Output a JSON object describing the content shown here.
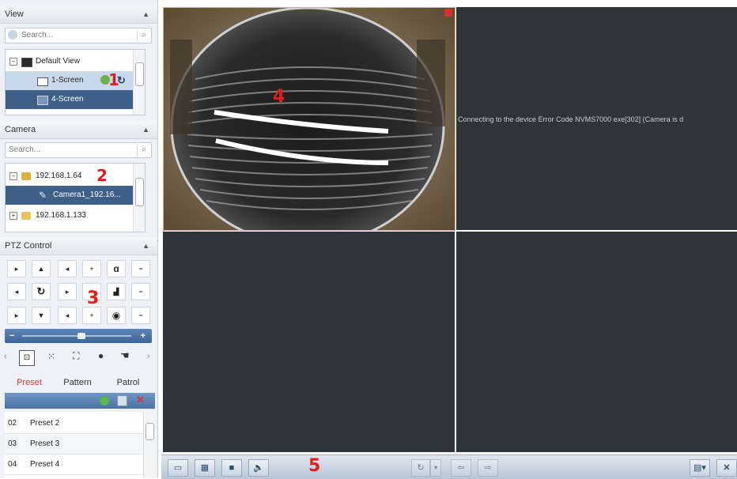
{
  "view_panel": {
    "title": "View",
    "search_placeholder": "Search...",
    "items": [
      {
        "label": "Default View"
      },
      {
        "label": "1-Screen"
      },
      {
        "label": "4-Screen"
      }
    ],
    "marker": "1"
  },
  "camera_panel": {
    "title": "Camera",
    "search_placeholder": "Search...",
    "items": [
      {
        "label": "192.168.1.64"
      },
      {
        "label": "Camera1_192.16..."
      },
      {
        "label": "192.168.1.133"
      }
    ],
    "marker": "2"
  },
  "ptz_panel": {
    "title": "PTZ Control",
    "marker": "3",
    "speed_minus": "−",
    "speed_plus": "+",
    "tabs": [
      "Preset",
      "Pattern",
      "Patrol"
    ],
    "active_tab": "Preset",
    "presets": [
      {
        "num": "02",
        "name": "Preset 2"
      },
      {
        "num": "03",
        "name": "Preset 3"
      },
      {
        "num": "04",
        "name": "Preset 4"
      }
    ]
  },
  "live_view": {
    "marker": "4",
    "error_message": "Connecting to the device Error Code NVMS7000 exe[302] (Camera is d"
  },
  "toolbar": {
    "marker": "5"
  },
  "colors": {
    "selected_row": "#3d5f88",
    "marker_red": "#e41c1c",
    "video_bg": "#2e3439",
    "toolbar_blue": "#c5d2e0"
  }
}
